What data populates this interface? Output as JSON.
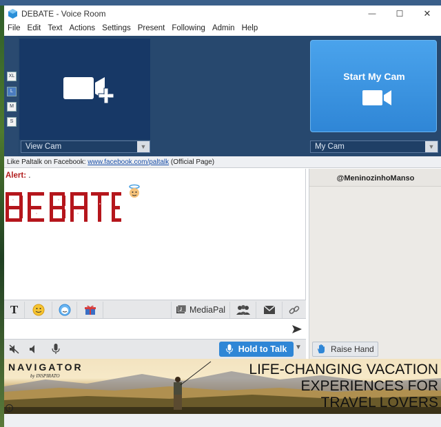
{
  "window": {
    "title": "DEBATE - Voice Room",
    "controls": {
      "minimize": "—",
      "maximize": "☐",
      "close": "✕"
    }
  },
  "menu": [
    "File",
    "Edit",
    "Text",
    "Actions",
    "Settings",
    "Present",
    "Following",
    "Admin",
    "Help"
  ],
  "video_size_buttons": [
    {
      "label": "XL",
      "active": false
    },
    {
      "label": "L",
      "active": true
    },
    {
      "label": "M",
      "active": false
    },
    {
      "label": "S",
      "active": false
    }
  ],
  "cams": {
    "view_cam_select": "View Cam",
    "start_cam_label": "Start My Cam",
    "my_cam_select": "My Cam"
  },
  "facebook_line": {
    "prefix": "Like Paltalk on Facebook: ",
    "link": "www.facebook.com/paltalk",
    "suffix": " (Official Page)"
  },
  "chat": {
    "alert_label": "Alert:",
    "alert_text": " ."
  },
  "toolbar": {
    "mediapal_label": "MediaPal"
  },
  "voice": {
    "hold_to_talk": "Hold to Talk",
    "raise_hand": "Raise Hand"
  },
  "userlist": {
    "header": "@MeninozinhoManso"
  },
  "ad": {
    "logo": "NAVIGATOR",
    "logo_sub": "by INSPIRATO",
    "headline": [
      "LIFE-CHANGING VACATION",
      "EXPERIENCES FOR",
      "TRAVEL LOVERS"
    ],
    "info": "i"
  },
  "colors": {
    "cam_bg": "#27486e",
    "start_cam": "#2f86d6",
    "alert": "#b11c1c",
    "debate_red": "#b5161c"
  }
}
